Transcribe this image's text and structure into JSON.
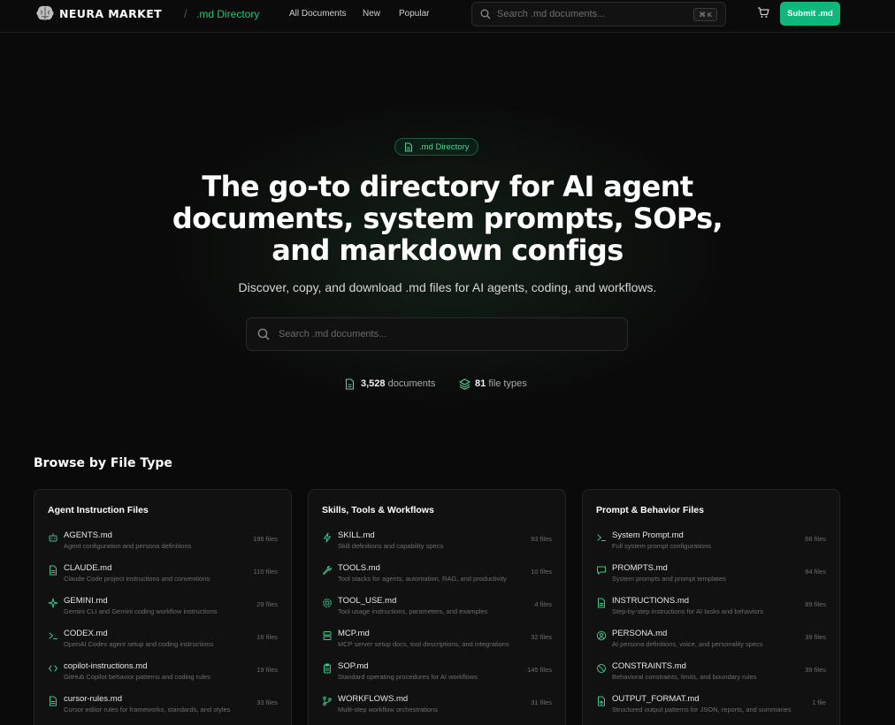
{
  "header": {
    "brand": "NEURA MARKET",
    "separator": "/",
    "section": ".md Directory",
    "nav": [
      "All Documents",
      "New",
      "Popular"
    ],
    "search_placeholder": "Search .md documents...",
    "shortcut": "⌘ K",
    "submit_label": "Submit .md",
    "accent": "#10b77a"
  },
  "hero": {
    "badge": ".md Directory",
    "title_lines": [
      "The go-to directory for AI agent",
      "documents, system prompts, SOPs,",
      "and markdown configs"
    ],
    "subtitle": "Discover, copy, and download .md files for AI agents, coding, and workflows.",
    "search_placeholder": "Search .md documents...",
    "stats": [
      {
        "value": "3,528",
        "label": "documents",
        "icon": "file-icon"
      },
      {
        "value": "81",
        "label": "file types",
        "icon": "layers-icon"
      }
    ]
  },
  "browse": {
    "heading": "Browse by File Type",
    "categories": [
      {
        "title": "Agent Instruction Files",
        "items": [
          {
            "name": "AGENTS.md",
            "desc": "Agent configuration and persona definitions",
            "count": "196 files",
            "icon": "robot-icon"
          },
          {
            "name": "CLAUDE.md",
            "desc": "Claude Code project instructions and conventions",
            "count": "110 files",
            "icon": "file-icon"
          },
          {
            "name": "GEMINI.md",
            "desc": "Gemini CLI and Gemini coding workflow instructions",
            "count": "29 files",
            "icon": "sparkle-icon"
          },
          {
            "name": "CODEX.md",
            "desc": "OpenAI Codex agent setup and coding instructions",
            "count": "16 files",
            "icon": "terminal-icon"
          },
          {
            "name": "copilot-instructions.md",
            "desc": "GitHub Copilot behavior patterns and coding rules",
            "count": "19 files",
            "icon": "code-icon"
          },
          {
            "name": "cursor-rules.md",
            "desc": "Cursor editor rules for frameworks, standards, and styles",
            "count": "33 files",
            "icon": "file-icon"
          }
        ]
      },
      {
        "title": "Skills, Tools & Workflows",
        "items": [
          {
            "name": "SKILL.md",
            "desc": "Skill definitions and capability specs",
            "count": "93 files",
            "icon": "bolt-icon"
          },
          {
            "name": "TOOLS.md",
            "desc": "Tool stacks for agents, automation, RAG, and productivity",
            "count": "10 files",
            "icon": "wrench-icon"
          },
          {
            "name": "TOOL_USE.md",
            "desc": "Tool usage instructions, parameters, and examples",
            "count": "4 files",
            "icon": "gear-icon"
          },
          {
            "name": "MCP.md",
            "desc": "MCP server setup docs, tool descriptions, and integrations",
            "count": "32 files",
            "icon": "server-icon"
          },
          {
            "name": "SOP.md",
            "desc": "Standard operating procedures for AI workflows",
            "count": "145 files",
            "icon": "clipboard-icon"
          },
          {
            "name": "WORKFLOWS.md",
            "desc": "Multi-step workflow orchestrations",
            "count": "31 files",
            "icon": "branch-icon"
          }
        ]
      },
      {
        "title": "Prompt & Behavior Files",
        "items": [
          {
            "name": "System Prompt.md",
            "desc": "Full system prompt configurations",
            "count": "68 files",
            "icon": "terminal-icon"
          },
          {
            "name": "PROMPTS.md",
            "desc": "System prompts and prompt templates",
            "count": "94 files",
            "icon": "chat-icon"
          },
          {
            "name": "INSTRUCTIONS.md",
            "desc": "Step-by-step instructions for AI tasks and behaviors",
            "count": "89 files",
            "icon": "file-icon"
          },
          {
            "name": "PERSONA.md",
            "desc": "AI persona definitions, voice, and personality specs",
            "count": "39 files",
            "icon": "user-icon"
          },
          {
            "name": "CONSTRAINTS.md",
            "desc": "Behavioral constraints, limits, and boundary rules",
            "count": "39 files",
            "icon": "ban-icon"
          },
          {
            "name": "OUTPUT_FORMAT.md",
            "desc": "Structured output patterns for JSON, reports, and summaries",
            "count": "1 file",
            "icon": "export-icon"
          }
        ]
      }
    ]
  }
}
